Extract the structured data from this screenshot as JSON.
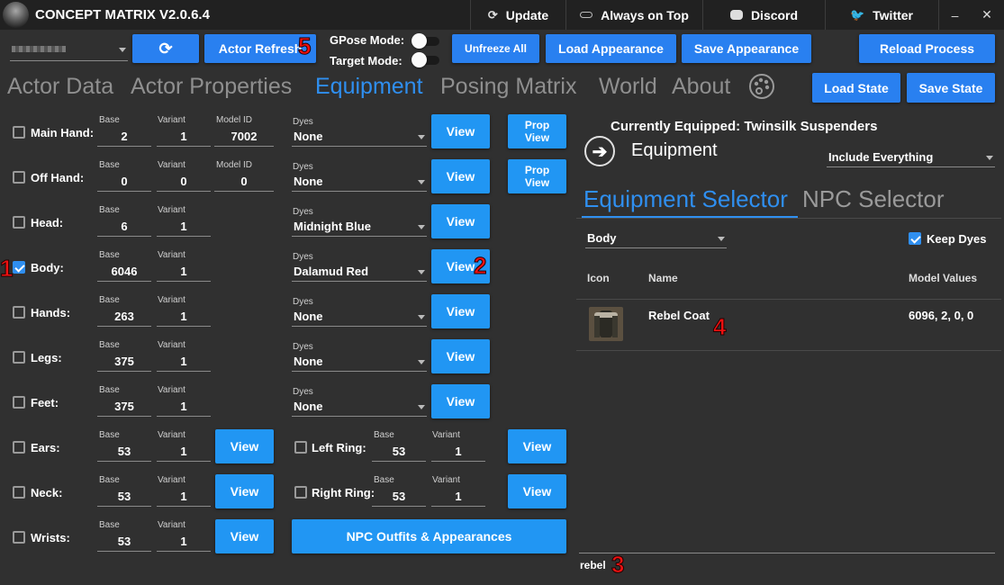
{
  "app": {
    "title": "CONCEPT MATRIX V2.0.6.4"
  },
  "titlebar": {
    "update": "Update",
    "always_on_top": "Always on Top",
    "discord": "Discord",
    "twitter": "Twitter",
    "minimize": "–",
    "close": "✕"
  },
  "toolbar": {
    "actor_select_value": "",
    "refresh_icon": "refresh-icon",
    "actor_refresh": "Actor Refresh",
    "gpose_mode": "GPose Mode:",
    "target_mode": "Target Mode:",
    "unfreeze_all": "Unfreeze All",
    "load_appearance": "Load Appearance",
    "save_appearance": "Save Appearance",
    "reload_process": "Reload Process",
    "load_state": "Load State",
    "save_state": "Save State"
  },
  "tabs": [
    "Actor Data",
    "Actor Properties",
    "Equipment",
    "Posing Matrix",
    "World",
    "About"
  ],
  "active_tab": "Equipment",
  "captions": {
    "base": "Base",
    "variant": "Variant",
    "model_id": "Model ID",
    "dyes": "Dyes"
  },
  "slots": [
    {
      "label": "Main Hand:",
      "checked": false,
      "base": "2",
      "variant": "1",
      "model_id": "7002",
      "dye": "None",
      "view": "View",
      "prop": "Prop\nView"
    },
    {
      "label": "Off Hand:",
      "checked": false,
      "base": "0",
      "variant": "0",
      "model_id": "0",
      "dye": "None",
      "view": "View",
      "prop": "Prop\nView"
    },
    {
      "label": "Head:",
      "checked": false,
      "base": "6",
      "variant": "1",
      "dye": "Midnight Blue",
      "view": "View"
    },
    {
      "label": "Body:",
      "checked": true,
      "base": "6046",
      "variant": "1",
      "dye": "Dalamud Red",
      "view": "View"
    },
    {
      "label": "Hands:",
      "checked": false,
      "base": "263",
      "variant": "1",
      "dye": "None",
      "view": "View"
    },
    {
      "label": "Legs:",
      "checked": false,
      "base": "375",
      "variant": "1",
      "dye": "None",
      "view": "View"
    },
    {
      "label": "Feet:",
      "checked": false,
      "base": "375",
      "variant": "1",
      "dye": "None",
      "view": "View"
    },
    {
      "label": "Ears:",
      "checked": false,
      "base": "53",
      "variant": "1",
      "view": "View"
    },
    {
      "label": "Neck:",
      "checked": false,
      "base": "53",
      "variant": "1",
      "view": "View"
    },
    {
      "label": "Wrists:",
      "checked": false,
      "base": "53",
      "variant": "1",
      "view": "View"
    }
  ],
  "rings": [
    {
      "label": "Left Ring:",
      "checked": false,
      "base": "53",
      "variant": "1",
      "view": "View"
    },
    {
      "label": "Right Ring:",
      "checked": false,
      "base": "53",
      "variant": "1",
      "view": "View"
    }
  ],
  "npc_outfits": "NPC Outfits & Appearances",
  "right": {
    "currently_equipped": "Currently Equipped: Twinsilk Suspenders",
    "equipment_label": "Equipment",
    "include_filter": "Include Everything",
    "subtabs": [
      "Equipment Selector",
      "NPC Selector"
    ],
    "slot_filter": "Body",
    "keep_dyes": "Keep Dyes",
    "keep_dyes_checked": true,
    "columns": [
      "Icon",
      "Name",
      "Model Values"
    ],
    "rows": [
      {
        "icon": "coat-icon",
        "name": "Rebel Coat",
        "model_values": "6096, 2, 0, 0"
      }
    ],
    "search_value": "rebel"
  },
  "markers": [
    "1",
    "2",
    "3",
    "4",
    "5"
  ],
  "colors": {
    "accent": "#2980f0",
    "accent_light": "#2196f3",
    "background": "#303030",
    "titlebar": "#212121",
    "marker": "#ee1111"
  }
}
